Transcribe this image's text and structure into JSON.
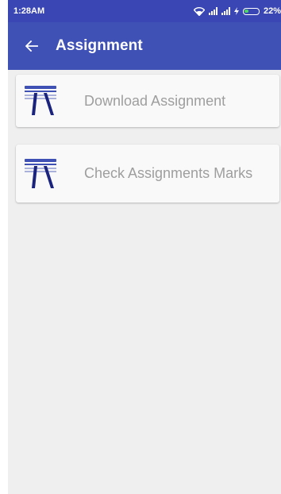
{
  "status_bar": {
    "time": "1:28AM",
    "battery": "22%"
  },
  "app_bar": {
    "back_icon": "arrow-left-icon",
    "title": "Assignment"
  },
  "menu": {
    "items": [
      {
        "label": "Download Assignment",
        "icon": "assignment-board-icon"
      },
      {
        "label": "Check Assignments Marks",
        "icon": "assignment-board-icon"
      }
    ]
  },
  "colors": {
    "app_bar": "#3f51b5",
    "status_bar": "#3a46b3",
    "background": "#efefef",
    "card": "#f9f9f9",
    "label_text": "#9e9e9e"
  }
}
